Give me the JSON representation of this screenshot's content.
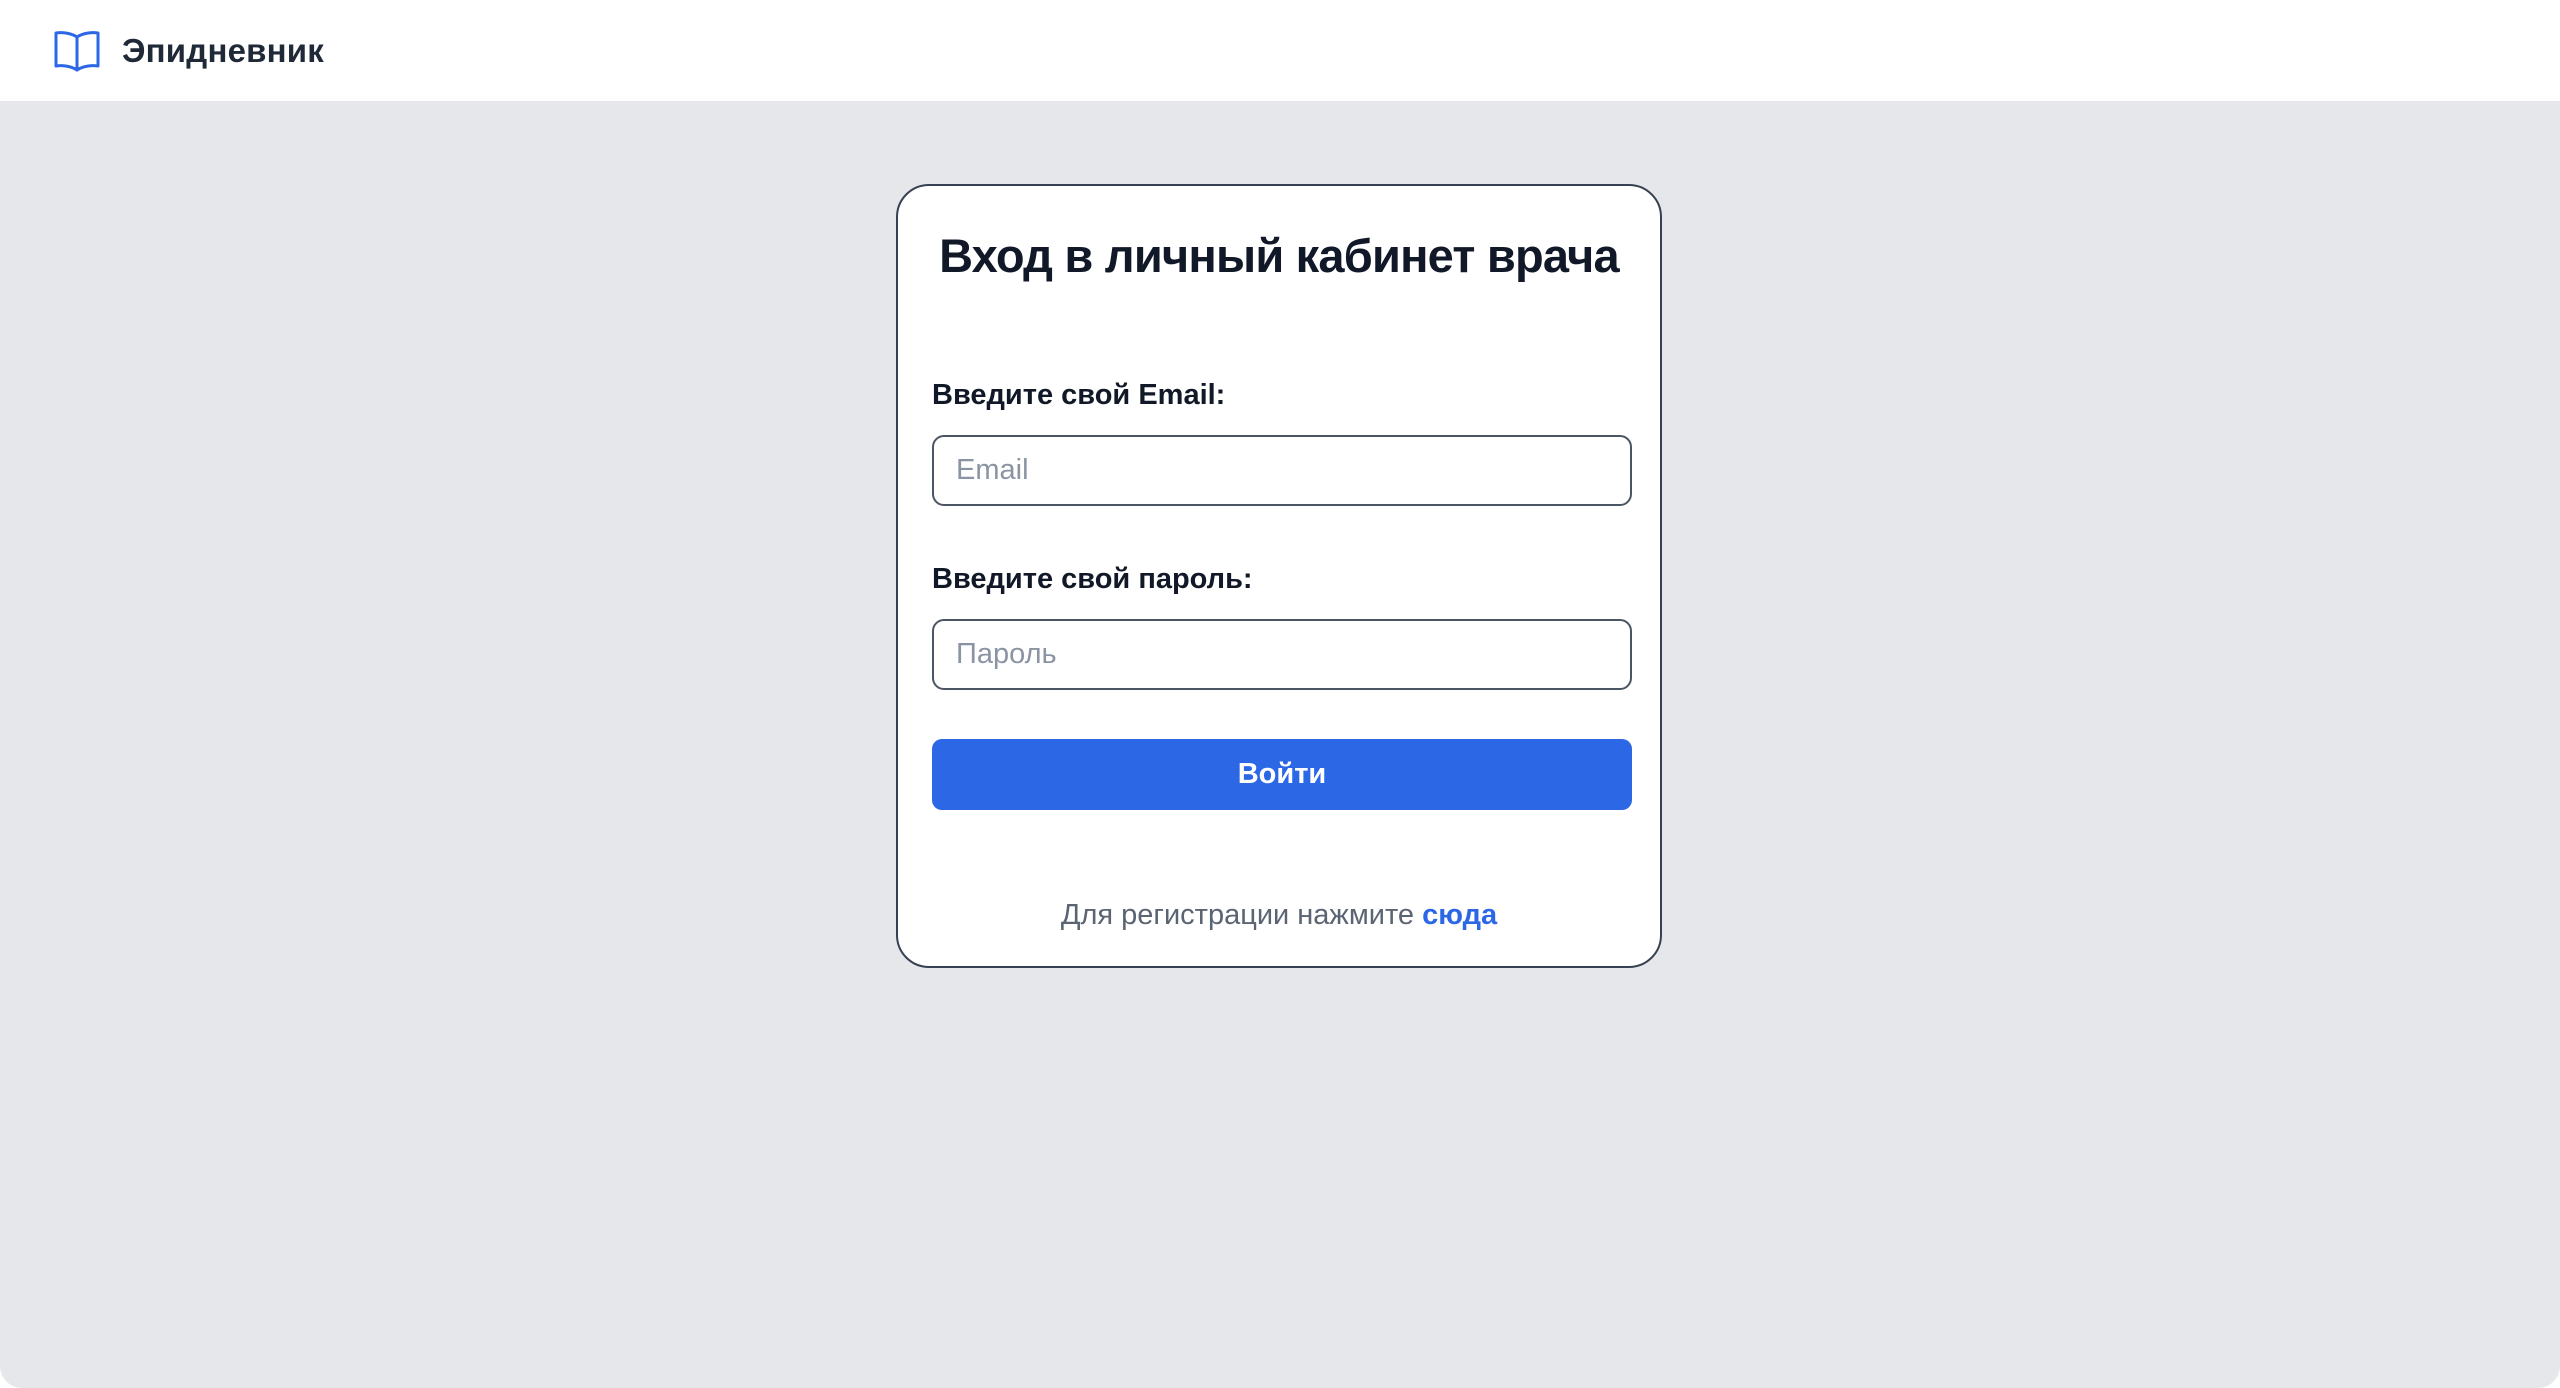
{
  "header": {
    "brand_icon": "open-book-icon",
    "brand_name": "Эпидневник"
  },
  "login_form": {
    "title": "Вход в личный кабинет врача",
    "email": {
      "label": "Введите свой Email:",
      "placeholder": "Email",
      "value": ""
    },
    "password": {
      "label": "Введите свой пароль:",
      "placeholder": "Пароль",
      "value": ""
    },
    "submit_label": "Войти",
    "register_prompt": "Для регистрации нажмите",
    "register_link": "сюда"
  },
  "colors": {
    "accent": "#2c67e6",
    "page_background": "#e5e7eb",
    "card_border": "#374151",
    "title_text": "#111827",
    "muted_text": "#5b6472"
  }
}
